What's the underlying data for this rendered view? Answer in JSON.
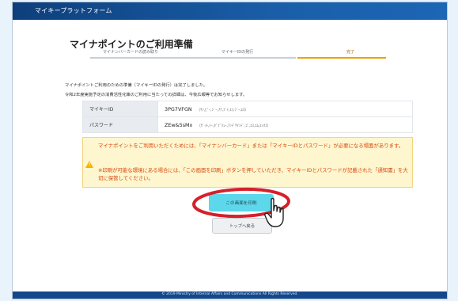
{
  "header": {
    "brand": "マイキープラットフォーム"
  },
  "page": {
    "title": "マイナポイントのご利用準備"
  },
  "steps": [
    {
      "label": "マイナンバーカードの読み取り"
    },
    {
      "label": "マイキーIDの発行"
    },
    {
      "label": "完了"
    }
  ],
  "messages": {
    "line1": "マイナポイントご利用のための準備（マイキーIDの発行）は完了しました。",
    "line2": "令和2年度実施予定の消費活性化策のご利用に当たっての詳細は、今後広報等でお知らせします。"
  },
  "info": {
    "id_label": "マイキーID",
    "id_value": "3PG7VFGN",
    "id_reading": "（ｻﾝ,ﾋﾟｰ,ｼﾞｰ,ﾅﾅ,ﾌﾞｲ,ｴﾌ,ｼﾞｰ,ｴﾇ）",
    "pw_label": "パスワード",
    "pw_value": "ZEw&5sMx",
    "pw_reading": "（ｾﾞｯﾄ,ｲｰ,ﾀﾞﾌﾞﾘｭｰ,ｱﾝﾄﾞｻｲﾝﾄﾞ,ｺﾞ,ｴｽ,ｴﾑ,ｴｯｸｽ）"
  },
  "notice": {
    "text1": "マイナポイントをご利用いただくためには、「マイナンバーカード」または「マイキーIDとパスワード」が必要になる場面があります。",
    "text2": "※印刷が可能な環境にある場合には、「この画面を印刷」ボタンを押していただき、マイキーIDとパスワードが記載された「通知書」を大切に保管してください。"
  },
  "buttons": {
    "print": "この画面を印刷",
    "top": "トップへ戻る"
  },
  "footer": {
    "copyright": "© 2019 Ministry of Internal Affairs and Communications All Rights Reserved."
  },
  "colors": {
    "header": "#1a5ea8",
    "accent": "#f0a000",
    "notice_text": "#d9480f",
    "print_button": "#5dd7ea",
    "highlight_ellipse": "#d6202a"
  },
  "icons": {
    "notice": "warning-icon",
    "pointer": "hand-cursor-icon"
  }
}
